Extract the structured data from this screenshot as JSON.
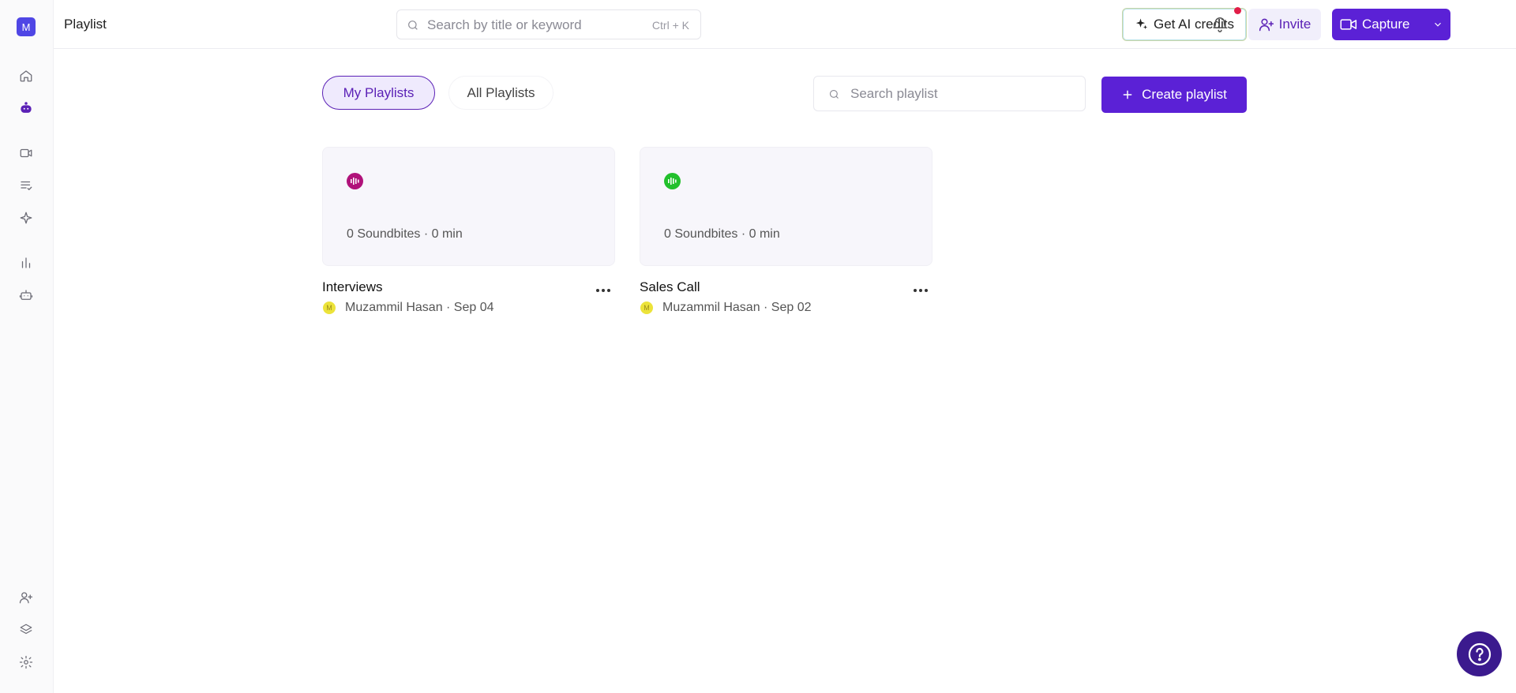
{
  "app": {
    "workspace_initial": "M",
    "page_title": "Playlist"
  },
  "header": {
    "search_placeholder": "Search by title or keyword",
    "search_shortcut": "Ctrl + K",
    "ai_credits_label": "Get AI credits",
    "invite_label": "Invite",
    "capture_label": "Capture",
    "notification_dot_color": "#e11d48"
  },
  "sidebar": {
    "top_items": [
      "home-icon",
      "assistant-icon",
      "video-icon",
      "playlist-icon",
      "sparkle-icon",
      "analytics-icon",
      "bot-icon"
    ],
    "bottom_items": [
      "add-user-icon",
      "layers-icon",
      "settings-icon"
    ]
  },
  "tabs": [
    {
      "label": "My Playlists",
      "active": true
    },
    {
      "label": "All Playlists",
      "active": false
    }
  ],
  "playlist_search": {
    "placeholder": "Search playlist"
  },
  "create_button_label": "Create playlist",
  "playlists": [
    {
      "title": "Interviews",
      "meta": "0 Soundbites · 0 min",
      "owner_initial": "M",
      "owner": "Muzammil Hasan · Sep 04",
      "badge_color": "#b0127a"
    },
    {
      "title": "Sales Call",
      "meta": "0 Soundbites · 0 min",
      "owner_initial": "M",
      "owner": "Muzammil Hasan · Sep 02",
      "badge_color": "#22c02c"
    }
  ],
  "colors": {
    "accent": "#5b21d6",
    "help_button": "#3b1a8e"
  }
}
